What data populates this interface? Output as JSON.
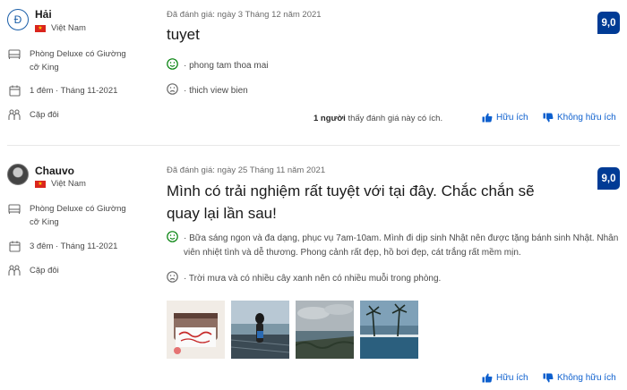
{
  "reviews": [
    {
      "avatar_letter": "Đ",
      "name": "Hải",
      "country": "Việt Nam",
      "room": "Phòng Deluxe có Giường cỡ King",
      "stay": "1 đêm · Tháng 11-2021",
      "group": "Cặp đôi",
      "date": "Đã đánh giá: ngày 3 Tháng 12 năm 2021",
      "title": "tuyet",
      "score": "9,0",
      "liked": "· phong tam thoa mai",
      "disliked": "· thich view bien",
      "helpful_count": "1 người",
      "helpful_text": " thấy đánh giá này có ích.",
      "helpful_label": "Hữu ích",
      "not_helpful_label": "Không hữu ích"
    },
    {
      "name": "Chauvo",
      "country": "Việt Nam",
      "room": "Phòng Deluxe có Giường cỡ King",
      "stay": "3 đêm · Tháng 11-2021",
      "group": "Cặp đôi",
      "date": "Đã đánh giá: ngày 25 Tháng 11 năm 2021",
      "title": "Mình có trải nghiệm rất tuyệt với tại đây. Chắc chắn sẽ quay lại lần sau!",
      "score": "9,0",
      "liked": "· Bữa sáng ngon và đa dạng, phục vụ 7am-10am. Mình đi dịp sinh Nhật nên được tặng bánh sinh Nhật. Nhân viên nhiệt tình và dễ thương. Phong cảnh rất đẹp, hồ bơi đẹp, cát trắng rất mềm mịn.",
      "disliked": "· Trời mưa và có nhiều cây xanh nên có nhiều muỗi trong phòng.",
      "helpful_label": "Hữu ích",
      "not_helpful_label": "Không hữu ích"
    }
  ],
  "colors": {
    "link": "#0c5fce",
    "score_bg": "#003b95",
    "liked": "#008009"
  }
}
